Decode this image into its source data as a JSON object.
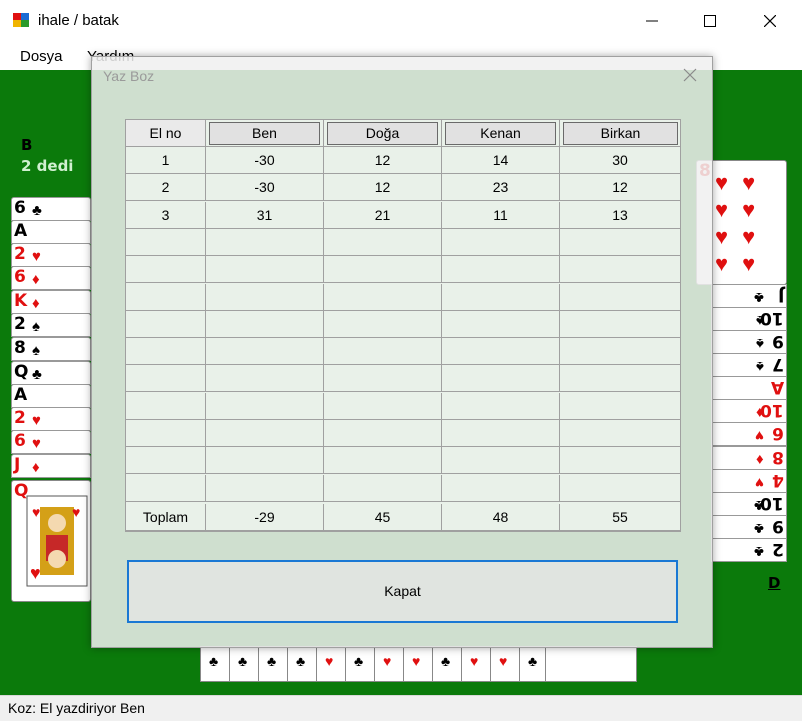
{
  "window": {
    "title": "ihale / batak"
  },
  "menu": {
    "items": [
      "Dosya",
      "Yardım"
    ]
  },
  "game": {
    "left_player": {
      "name": "B",
      "bid_text": "2 dedi"
    },
    "right_player_label": "D",
    "left_hand": [
      {
        "rank": "6",
        "suit": "♣",
        "color": "#000000"
      },
      {
        "rank": "A",
        "suit": "",
        "color": "#000000"
      },
      {
        "rank": "2",
        "suit": "♥",
        "color": "#e01010"
      },
      {
        "rank": "6",
        "suit": "♦",
        "color": "#e01010"
      },
      {
        "rank": "K",
        "suit": "♦",
        "color": "#e01010"
      },
      {
        "rank": "2",
        "suit": "♠",
        "color": "#000000"
      },
      {
        "rank": "8",
        "suit": "♠",
        "color": "#000000"
      },
      {
        "rank": "Q",
        "suit": "♣",
        "color": "#000000"
      },
      {
        "rank": "A",
        "suit": "",
        "color": "#000000"
      },
      {
        "rank": "2",
        "suit": "♥",
        "color": "#e01010"
      },
      {
        "rank": "6",
        "suit": "♥",
        "color": "#e01010"
      },
      {
        "rank": "J",
        "suit": "♦",
        "color": "#e01010"
      },
      {
        "rank": "Q",
        "suit": "♥",
        "color": "#e01010"
      }
    ],
    "right_hand": [
      {
        "rank": "J",
        "suit": "♣",
        "color": "#000000"
      },
      {
        "rank": "10",
        "suit": "♠",
        "color": "#000000"
      },
      {
        "rank": "9",
        "suit": "♠",
        "color": "#000000"
      },
      {
        "rank": "7",
        "suit": "♠",
        "color": "#000000"
      },
      {
        "rank": "A",
        "suit": "",
        "color": "#e01010"
      },
      {
        "rank": "10",
        "suit": "♦",
        "color": "#e01010"
      },
      {
        "rank": "6",
        "suit": "♥",
        "color": "#e01010"
      },
      {
        "rank": "8",
        "suit": "♦",
        "color": "#e01010"
      },
      {
        "rank": "4",
        "suit": "♥",
        "color": "#e01010"
      },
      {
        "rank": "10",
        "suit": "♣",
        "color": "#000000"
      },
      {
        "rank": "9",
        "suit": "♣",
        "color": "#000000"
      },
      {
        "rank": "2",
        "suit": "♣",
        "color": "#000000"
      }
    ]
  },
  "status": {
    "text": "Koz:  El yazdiriyor Ben"
  },
  "dialog": {
    "title": "Yaz Boz",
    "columns": [
      "El no",
      "Ben",
      "Doğa",
      "Kenan",
      "Birkan"
    ],
    "rows": [
      [
        "1",
        "-30",
        "12",
        "14",
        "30"
      ],
      [
        "2",
        "-30",
        "12",
        "23",
        "12"
      ],
      [
        "3",
        "31",
        "21",
        "11",
        "13"
      ]
    ],
    "empty_row_count": 10,
    "total": [
      "Toplam",
      "-29",
      "45",
      "48",
      "55"
    ],
    "close_button": "Kapat"
  }
}
